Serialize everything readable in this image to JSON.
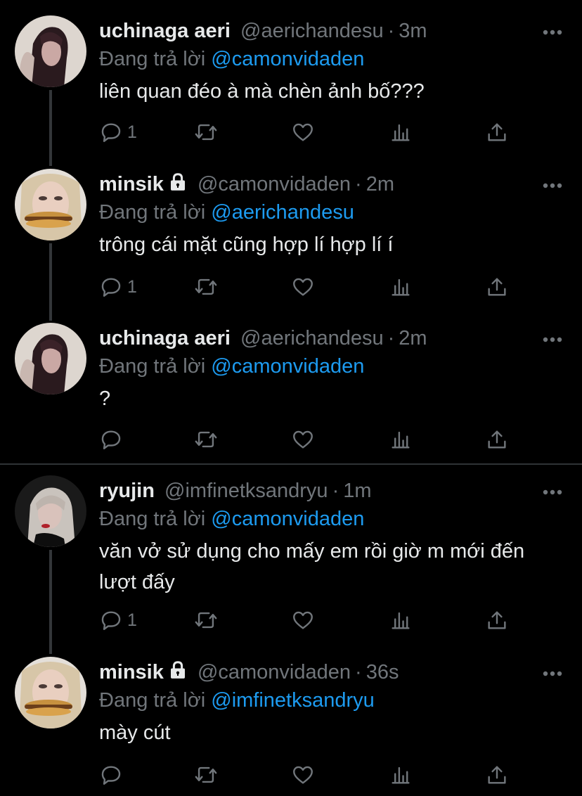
{
  "reply_prefix": "Đang trả lời",
  "dot": "·",
  "tweets": [
    {
      "name": "uchinaga aeri",
      "handle": "@aerichandesu",
      "time": "3m",
      "reply_to": "@camonvidaden",
      "text": "liên quan đéo à mà chèn ảnh bố???",
      "reply_count": "1",
      "locked": false,
      "avatar": "aeri-avatar"
    },
    {
      "name": "minsik",
      "handle": "@camonvidaden",
      "time": "2m",
      "reply_to": "@aerichandesu",
      "text": "trông cái mặt cũng hợp lí hợp lí í",
      "reply_count": "1",
      "locked": true,
      "avatar": "minsik-avatar"
    },
    {
      "name": "uchinaga aeri",
      "handle": "@aerichandesu",
      "time": "2m",
      "reply_to": "@camonvidaden",
      "text": "?",
      "reply_count": "",
      "locked": false,
      "avatar": "aeri-avatar"
    },
    {
      "name": "ryujin",
      "handle": "@imfinetksandryu",
      "time": "1m",
      "reply_to": "@camonvidaden",
      "text": "văn vở sử dụng cho mấy em rồi giờ m mới đến lượt đấy",
      "reply_count": "1",
      "locked": false,
      "avatar": "ryujin-avatar"
    },
    {
      "name": "minsik",
      "handle": "@camonvidaden",
      "time": "36s",
      "reply_to": "@imfinetksandryu",
      "text": "mày cút",
      "reply_count": "",
      "locked": true,
      "avatar": "minsik-avatar"
    }
  ],
  "colors": {
    "background": "#000000",
    "mention": "#1d9bf0",
    "secondary": "#71767b",
    "primary_text": "#e7e9ea"
  }
}
